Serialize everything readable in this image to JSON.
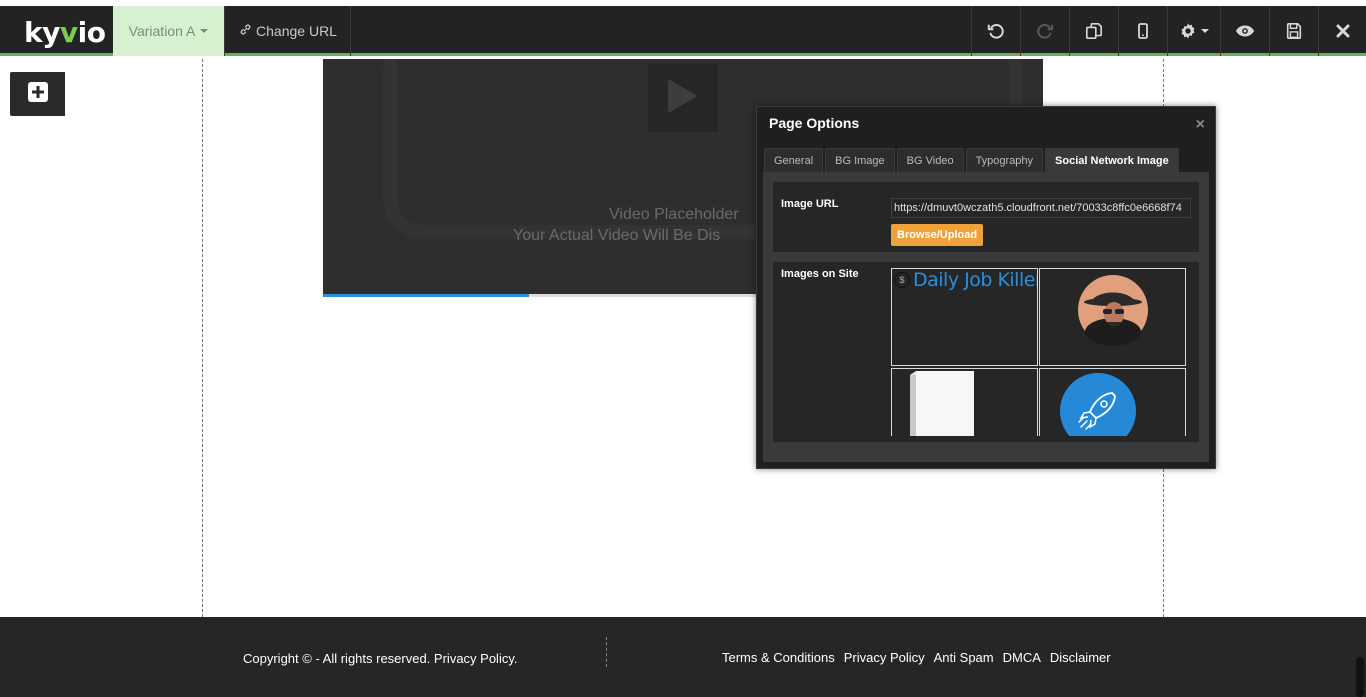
{
  "toolbar": {
    "logo_text_1": "ky",
    "logo_text_v": "v",
    "logo_text_2": "io",
    "variation_label": "Variation A",
    "change_url_label": "Change URL"
  },
  "video": {
    "placeholder_line1": "Video Placeholder",
    "placeholder_line2": "Your Actual Video Will Be Dis",
    "progress": 0.286
  },
  "modal": {
    "title": "Page Options",
    "close_label": "×",
    "tabs": [
      {
        "label": "General",
        "active": false
      },
      {
        "label": "BG Image",
        "active": false
      },
      {
        "label": "BG Video",
        "active": false
      },
      {
        "label": "Typography",
        "active": false
      },
      {
        "label": "Social Network Image",
        "active": true
      }
    ],
    "image_url_label": "Image URL",
    "image_url_value": "https://dmuvt0wczath5.cloudfront.net/70033c8ffc0e6668f74",
    "browse_label": "Browse/Upload",
    "images_on_site_label": "Images on Site",
    "thumb_djk_text": "Daily Job Killer",
    "thumb_djk_coin": "$"
  },
  "footer": {
    "copyright": "Copyright © - All rights reserved. Privacy Policy.",
    "links": [
      "Terms & Conditions",
      "Privacy Policy",
      "Anti Spam",
      "DMCA",
      "Disclaimer"
    ]
  },
  "colors": {
    "accent_green": "#5cb85c",
    "toolbar_bg": "#232323",
    "browse_orange": "#f0a13a",
    "djk_blue": "#2a8fd8",
    "rocket_blue": "#2589d8"
  }
}
